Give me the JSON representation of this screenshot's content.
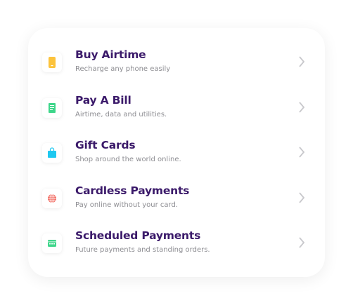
{
  "items": [
    {
      "title": "Buy Airtime",
      "subtitle": "Recharge any phone easily",
      "icon": "phone-icon",
      "color": "#fcc33c"
    },
    {
      "title": "Pay A Bill",
      "subtitle": "Airtime, data and utilities.",
      "icon": "receipt-icon",
      "color": "#3ed68a"
    },
    {
      "title": "Gift Cards",
      "subtitle": "Shop around the world online.",
      "icon": "shopping-bag-icon",
      "color": "#1ec8f0"
    },
    {
      "title": "Cardless Payments",
      "subtitle": "Pay online without your card.",
      "icon": "globe-icon",
      "color": "#f2645a"
    },
    {
      "title": "Scheduled Payments",
      "subtitle": "Future payments and standing orders.",
      "icon": "calendar-icon",
      "color": "#3ed68a"
    }
  ],
  "colors": {
    "title": "#3b1a6a",
    "subtitle": "#8d8d92",
    "chevron": "#c8c8cc"
  }
}
